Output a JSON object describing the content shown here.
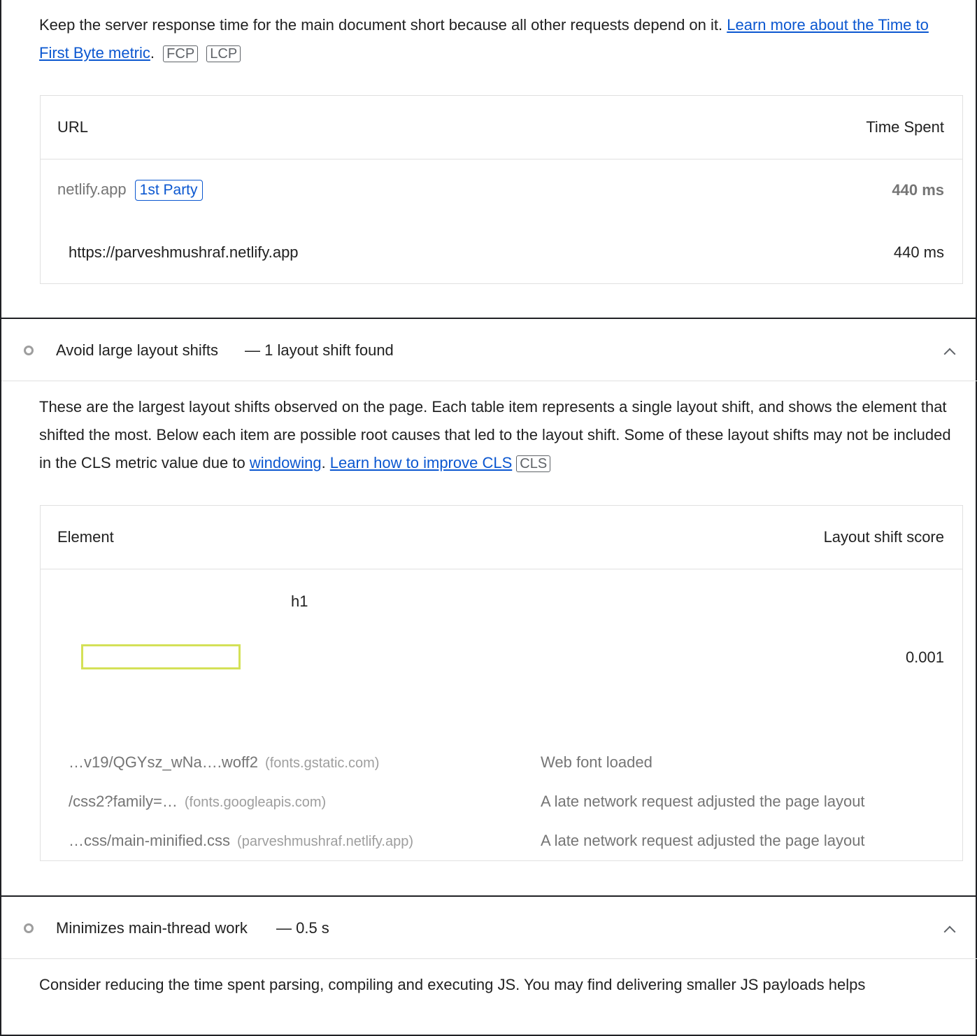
{
  "ttfb": {
    "desc_text": "Keep the server response time for the main document short because all other requests depend on it. ",
    "link_text": "Learn more about the Time to First Byte metric",
    "after_link": ".",
    "tags": [
      "FCP",
      "LCP"
    ],
    "table": {
      "col_url": "URL",
      "col_time": "Time Spent",
      "group_host": "netlify.app",
      "group_badge": "1st Party",
      "group_time": "440 ms",
      "row_url": "https://parveshmushraf.netlify.app",
      "row_time": "440 ms"
    }
  },
  "cls_audit": {
    "title": "Avoid large layout shifts",
    "display_value": "— 1 layout shift found",
    "desc_text": "These are the largest layout shifts observed on the page. Each table item represents a single layout shift, and shows the element that shifted the most. Below each item are possible root causes that led to the layout shift. Some of these layout shifts may not be included in the CLS metric value due to ",
    "link1": "windowing",
    "between_links": ". ",
    "link2": "Learn how to improve CLS",
    "tag": "CLS",
    "table": {
      "col_element": "Element",
      "col_score": "Layout shift score",
      "element_label": "h1",
      "score": "0.001",
      "causes": [
        {
          "url": "…v19/QGYsz_wNa….woff2",
          "host": "(fonts.gstatic.com)",
          "reason": "Web font loaded"
        },
        {
          "url": "/css2?family=…",
          "host": "(fonts.googleapis.com)",
          "reason": "A late network request adjusted the page layout"
        },
        {
          "url": "…css/main-minified.css",
          "host": "(parveshmushraf.netlify.app)",
          "reason": "A late network request adjusted the page layout"
        }
      ]
    }
  },
  "mainthread_audit": {
    "title": "Minimizes main-thread work",
    "display_value": "— 0.5 s",
    "desc_text": "Consider reducing the time spent parsing, compiling and executing JS. You may find delivering smaller JS payloads helps"
  },
  "colors": {
    "link": "#0b57d0",
    "element_highlight": "#d4e157",
    "border": "#202124"
  }
}
